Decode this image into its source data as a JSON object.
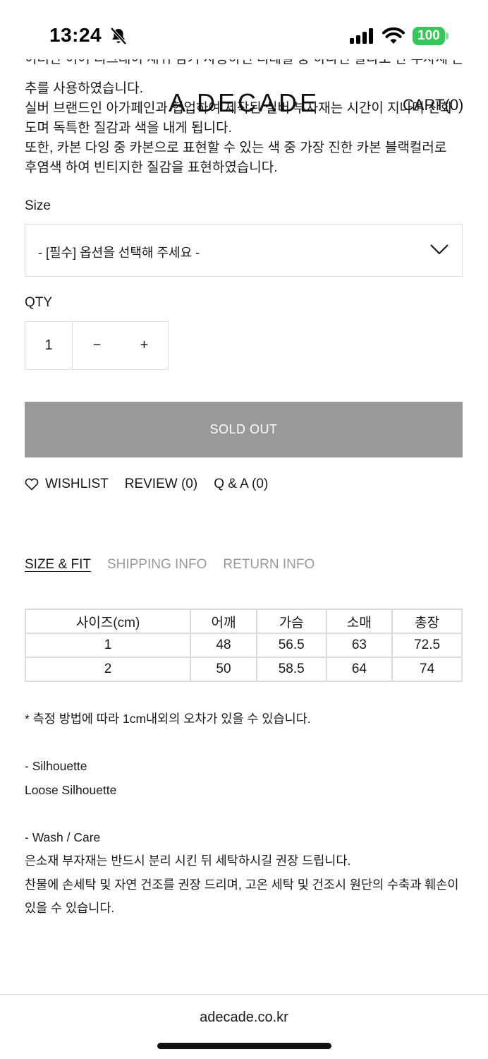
{
  "status_bar": {
    "time": "13:24",
    "battery": "100",
    "icons": [
      "bell-slash-icon",
      "signal-icon",
      "wifi-icon",
      "battery-icon"
    ]
  },
  "header": {
    "logo": "A DECADE",
    "cart": "CART(0)"
  },
  "description": {
    "partial_line": "이러한 이어 리그래이 새쉬 남기 사용하던 디테일 중 하나인 칼라로 만 부자재 는",
    "lines": [
      "추를 사용하였습니다.",
      "실버 브랜드인 아가페인과 협업하여 제작된 실버 부자재는 시간이 지나며 산화",
      "도며 독특한 질감과 색을 내게 됩니다.",
      "또한, 카본 다잉 중 카본으로 표현할 수 있는 색 중 가장 진한 카본 블랙컬러로",
      "후염색 하여 빈티지한 질감을 표현하였습니다."
    ]
  },
  "size_option": {
    "label": "Size",
    "selected": "- [필수] 옵션을 선택해 주세요 -"
  },
  "qty": {
    "label": "QTY",
    "value": "1",
    "minus": "−",
    "plus": "+"
  },
  "buy_button": "SOLD OUT",
  "actions": {
    "wishlist": "WISHLIST",
    "review": "REVIEW (0)",
    "qna": "Q & A (0)"
  },
  "info_tabs": {
    "active": "SIZE & FIT",
    "shipping": "SHIPPING INFO",
    "return": "RETURN INFO"
  },
  "size_table": {
    "headers": [
      "사이즈(cm)",
      "어깨",
      "가슴",
      "소매",
      "총장"
    ],
    "rows": [
      [
        "1",
        "48",
        "56.5",
        "63",
        "72.5"
      ],
      [
        "2",
        "50",
        "58.5",
        "64",
        "74"
      ]
    ]
  },
  "notes": {
    "measure_note": "* 측정 방법에 따라 1cm내외의 오차가 있을 수 있습니다.",
    "silhouette_title": "- Silhouette",
    "silhouette_value": "Loose Silhouette",
    "care_title": "- Wash / Care",
    "care_lines": [
      "은소재 부자재는 반드시 분리 시킨 뒤 세탁하시길 권장 드립니다.",
      "찬물에 손세탁 및 자연 건조를 권장 드리며, 고온 세탁 및 건조시 원단의 수축과 훼손이",
      "있을 수 있습니다."
    ]
  },
  "footer": {
    "url": "adecade.co.kr"
  }
}
